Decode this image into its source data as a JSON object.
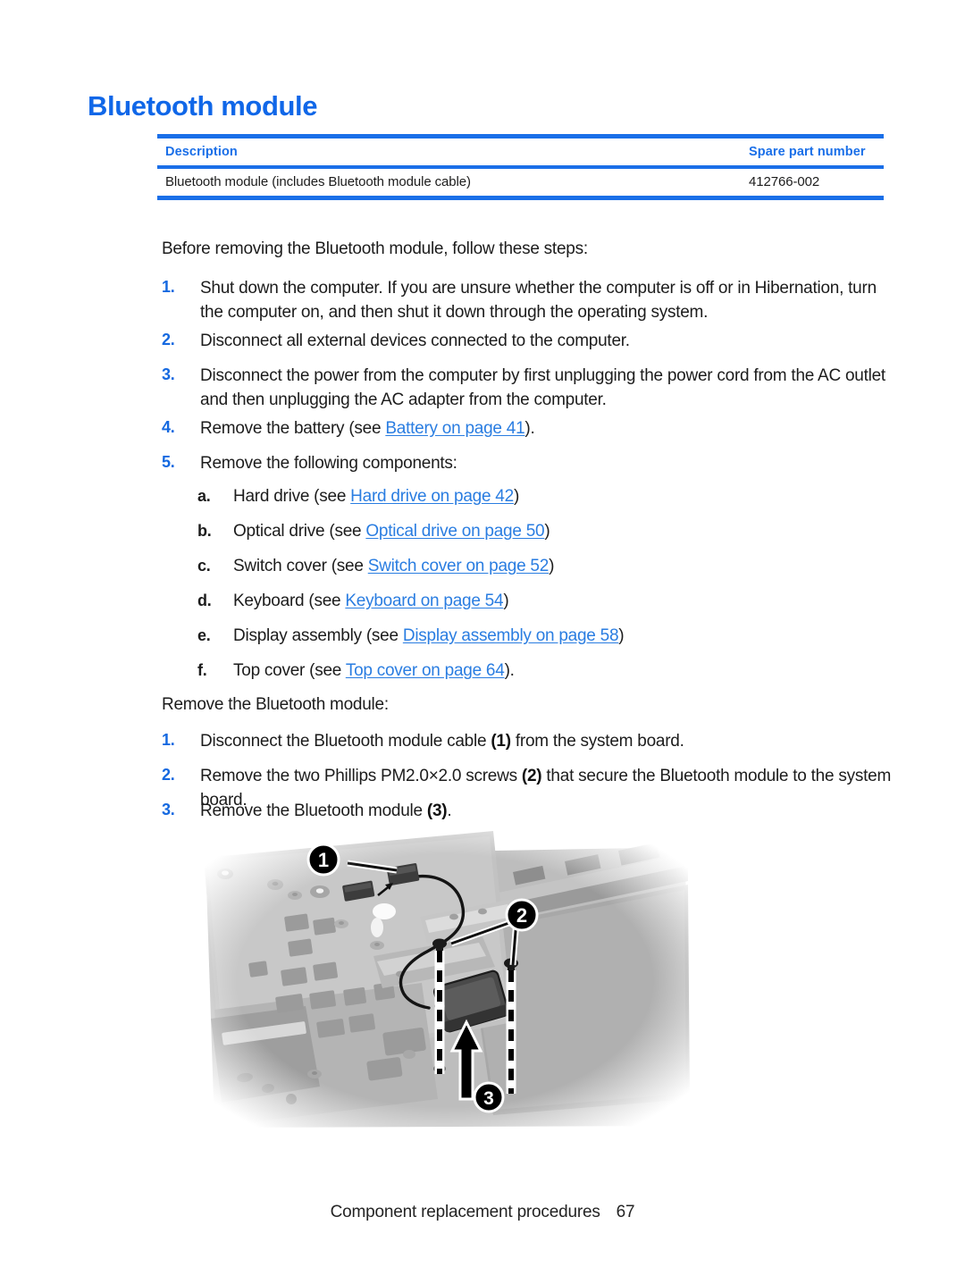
{
  "document": {
    "title": "Bluetooth module"
  },
  "spec_table": {
    "headers": {
      "description": "Description",
      "spare_part_number": "Spare part number"
    },
    "rows": [
      {
        "description": "Bluetooth module (includes Bluetooth module cable)",
        "spare_part_number": "412766-002"
      }
    ]
  },
  "before_section": {
    "lead": "Before removing the Bluetooth module, follow these steps:",
    "steps": [
      {
        "num": "1.",
        "text": "Shut down the computer. If you are unsure whether the computer is off or in Hibernation, turn the computer on, and then shut it down through the operating system."
      },
      {
        "num": "2.",
        "text": "Disconnect all external devices connected to the computer."
      },
      {
        "num": "3.",
        "text": "Disconnect the power from the computer by first unplugging the power cord from the AC outlet and then unplugging the AC adapter from the computer."
      },
      {
        "num": "4.",
        "prefix": "Remove the battery (see ",
        "link": "Battery on page 41",
        "suffix": ")."
      },
      {
        "num": "5.",
        "text": "Remove the following components:"
      }
    ],
    "substeps": [
      {
        "num": "a.",
        "prefix": "Hard drive (see ",
        "link": "Hard drive on page 42",
        "suffix": ")"
      },
      {
        "num": "b.",
        "prefix": "Optical drive (see ",
        "link": "Optical drive on page 50",
        "suffix": ")"
      },
      {
        "num": "c.",
        "prefix": "Switch cover (see ",
        "link": "Switch cover on page 52",
        "suffix": ")"
      },
      {
        "num": "d.",
        "prefix": "Keyboard (see ",
        "link": "Keyboard on page 54",
        "suffix": ")"
      },
      {
        "num": "e.",
        "prefix": "Display assembly (see ",
        "link": "Display assembly on page 58",
        "suffix": ")"
      },
      {
        "num": "f.",
        "prefix": "Top cover (see ",
        "link": "Top cover on page 64",
        "suffix": ")."
      }
    ]
  },
  "remove_section": {
    "lead": "Remove the Bluetooth module:",
    "steps": [
      {
        "num": "1.",
        "prefix": "Disconnect the Bluetooth module cable ",
        "cue": "(1)",
        "suffix": " from the system board."
      },
      {
        "num": "2.",
        "prefix": "Remove the two Phillips PM2.0×2.0 screws ",
        "cue": "(2)",
        "suffix": " that secure the Bluetooth module to the system board."
      },
      {
        "num": "3.",
        "prefix": "Remove the Bluetooth module ",
        "cue": "(3)",
        "suffix": "."
      }
    ]
  },
  "figure": {
    "callouts": [
      {
        "id": "1",
        "label": "1",
        "meaning": "bluetooth-module-cable-connector"
      },
      {
        "id": "2",
        "label": "2",
        "meaning": "phillips-pm2.0x2.0-screws"
      },
      {
        "id": "3",
        "label": "3",
        "meaning": "bluetooth-module"
      }
    ]
  },
  "footer": {
    "text": "Component replacement procedures",
    "page_number": "67"
  },
  "colors": {
    "title_blue": "#1067e8",
    "rule_blue": "#1a6fe8",
    "link_blue": "#2a7de1",
    "step_number_blue": "#1569e0"
  }
}
